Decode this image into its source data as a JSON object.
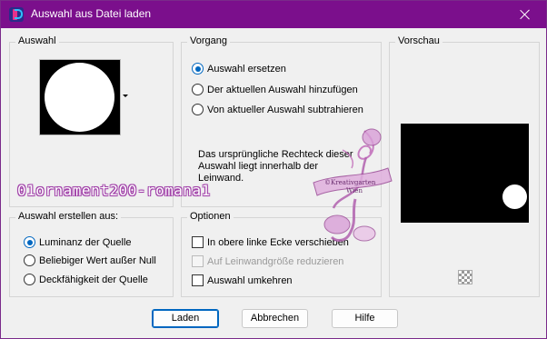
{
  "window": {
    "title": "Auswahl aus Datei laden"
  },
  "auswahl": {
    "legend": "Auswahl"
  },
  "vorgang": {
    "legend": "Vorgang",
    "options": [
      {
        "label": "Auswahl ersetzen",
        "checked": true
      },
      {
        "label": "Der aktuellen Auswahl hinzufügen",
        "checked": false
      },
      {
        "label": "Von aktueller Auswahl subtrahieren",
        "checked": false
      }
    ],
    "info_line1": "Das ursprüngliche Rechteck dieser",
    "info_line2": "Auswahl liegt innerhalb der",
    "info_line3": "Leinwand."
  },
  "vorschau": {
    "legend": "Vorschau"
  },
  "watermark_text": "01ornament200-romana1",
  "stamp": {
    "line1": "©Kreativgarten",
    "line2": "Wien"
  },
  "erstellen": {
    "legend": "Auswahl erstellen aus:",
    "options": [
      {
        "label": "Luminanz der Quelle",
        "checked": true
      },
      {
        "label": "Beliebiger Wert außer Null",
        "checked": false
      },
      {
        "label": "Deckfähigkeit der Quelle",
        "checked": false
      }
    ]
  },
  "optionen": {
    "legend": "Optionen",
    "checkboxes": [
      {
        "label": "In obere linke Ecke verschieben",
        "checked": false,
        "disabled": false
      },
      {
        "label": "Auf Leinwandgröße reduzieren",
        "checked": false,
        "disabled": true
      },
      {
        "label": "Auswahl umkehren",
        "checked": false,
        "disabled": false
      }
    ]
  },
  "buttons": {
    "laden": "Laden",
    "abbrechen": "Abbrechen",
    "hilfe": "Hilfe"
  },
  "colors": {
    "titlebar": "#7b0f8c",
    "accent": "#0067c0",
    "watermark_outline": "#a040a8"
  }
}
